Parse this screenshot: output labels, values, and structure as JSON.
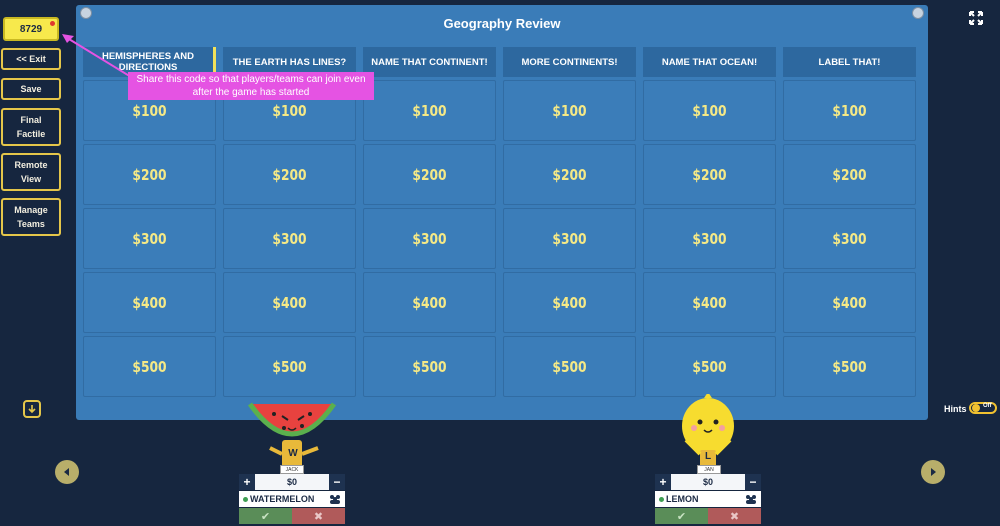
{
  "game_code": "8729",
  "sidebar": {
    "exit_label": "<< Exit",
    "save_label": "Save",
    "final_factile_label": "Final Factile",
    "remote_view_label": "Remote View",
    "manage_teams_label": "Manage Teams"
  },
  "board": {
    "title": "Geography Review",
    "categories": [
      "HEMISPHERES AND DIRECTIONS",
      "THE EARTH HAS LINES?",
      "NAME THAT CONTINENT!",
      "MORE CONTINENTS!",
      "NAME THAT OCEAN!",
      "LABEL THAT!"
    ],
    "values": [
      "$100",
      "$200",
      "$300",
      "$400",
      "$500"
    ]
  },
  "tooltip": {
    "text": "Share this code so that players/teams can join even after the game has started"
  },
  "hints": {
    "label": "Hints",
    "state": "Off"
  },
  "teams": [
    {
      "player": "JACK",
      "score": "$0",
      "name": "WATERMELON",
      "avatar_letter": "W"
    },
    {
      "player": "JAN",
      "score": "$0",
      "name": "LEMON",
      "avatar_letter": "L"
    }
  ],
  "colors": {
    "board": "#3a7cb8",
    "value_text": "#f5e986",
    "tooltip": "#e553e3",
    "accent": "#e4c64a"
  }
}
